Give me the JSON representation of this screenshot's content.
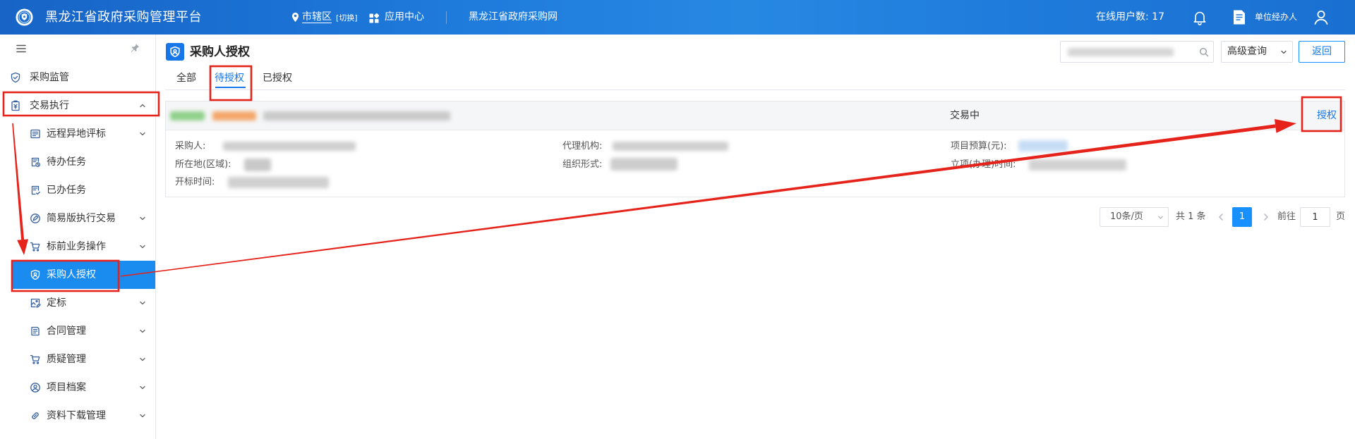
{
  "header": {
    "title": "黑龙江省政府采购管理平台",
    "region": "市辖区",
    "region_switch": "[切换]",
    "app_center": "应用中心",
    "portal_link": "黑龙江省政府采购网",
    "online_users": "在线用户数: 17",
    "user_role": "单位经办人",
    "icons": {
      "logo": "emblem-icon",
      "region": "location-pin-icon",
      "app_center": "apps-grid-icon",
      "notifications": "bell-icon",
      "role": "document-icon",
      "account": "user-icon"
    }
  },
  "sidebar": {
    "toggle_icon": "menu-icon",
    "pin_icon": "pin-icon",
    "items": [
      {
        "label": "采购监管",
        "icon": "shield-check-icon",
        "level": 0
      },
      {
        "label": "交易执行",
        "icon": "clipboard-icon",
        "level": 0,
        "expanded": true
      },
      {
        "label": "远程异地评标",
        "icon": "monitor-list-icon",
        "level": 1,
        "has_children": true
      },
      {
        "label": "待办任务",
        "icon": "document-clock-icon",
        "level": 1
      },
      {
        "label": "已办任务",
        "icon": "document-check-icon",
        "level": 1
      },
      {
        "label": "简易版执行交易",
        "icon": "circle-tag-icon",
        "level": 1,
        "has_children": true
      },
      {
        "label": "标前业务操作",
        "icon": "cart-icon",
        "level": 1,
        "has_children": true
      },
      {
        "label": "采购人授权",
        "icon": "shield-user-icon",
        "level": 1,
        "active": true
      },
      {
        "label": "定标",
        "icon": "image-edit-icon",
        "level": 1,
        "has_children": true
      },
      {
        "label": "合同管理",
        "icon": "document-lines-icon",
        "level": 1,
        "has_children": true
      },
      {
        "label": "质疑管理",
        "icon": "cart-icon",
        "level": 1,
        "has_children": true
      },
      {
        "label": "项目档案",
        "icon": "user-circle-icon",
        "level": 1,
        "has_children": true
      },
      {
        "label": "资料下载管理",
        "icon": "link-icon",
        "level": 1,
        "has_children": true
      }
    ]
  },
  "page": {
    "title": "采购人授权",
    "title_icon": "shield-user-icon",
    "search_icon": "search-icon",
    "advanced_search": "高级查询",
    "back": "返回",
    "tabs": [
      {
        "label": "全部"
      },
      {
        "label": "待授权",
        "active": true
      },
      {
        "label": "已授权"
      }
    ]
  },
  "card": {
    "status": "交易中",
    "action": "授权",
    "fields": {
      "purchaser": "采购人:",
      "agency": "代理机构:",
      "budget": "项目预算(元):",
      "region": "所在地(区域):",
      "organization": "组织形式:",
      "setup_time": "立项(办理)时间:",
      "bid_open_time": "开标时间:"
    }
  },
  "pagination": {
    "page_size": "10条/页",
    "total": "共 1 条",
    "current_page": "1",
    "goto_label": "前往",
    "goto_value": "1",
    "page_suffix": "页"
  },
  "colors": {
    "header": "#1d78da",
    "accent": "#1890ff",
    "active_menu": "#1a8cf0",
    "annotation": "#e5231b"
  }
}
